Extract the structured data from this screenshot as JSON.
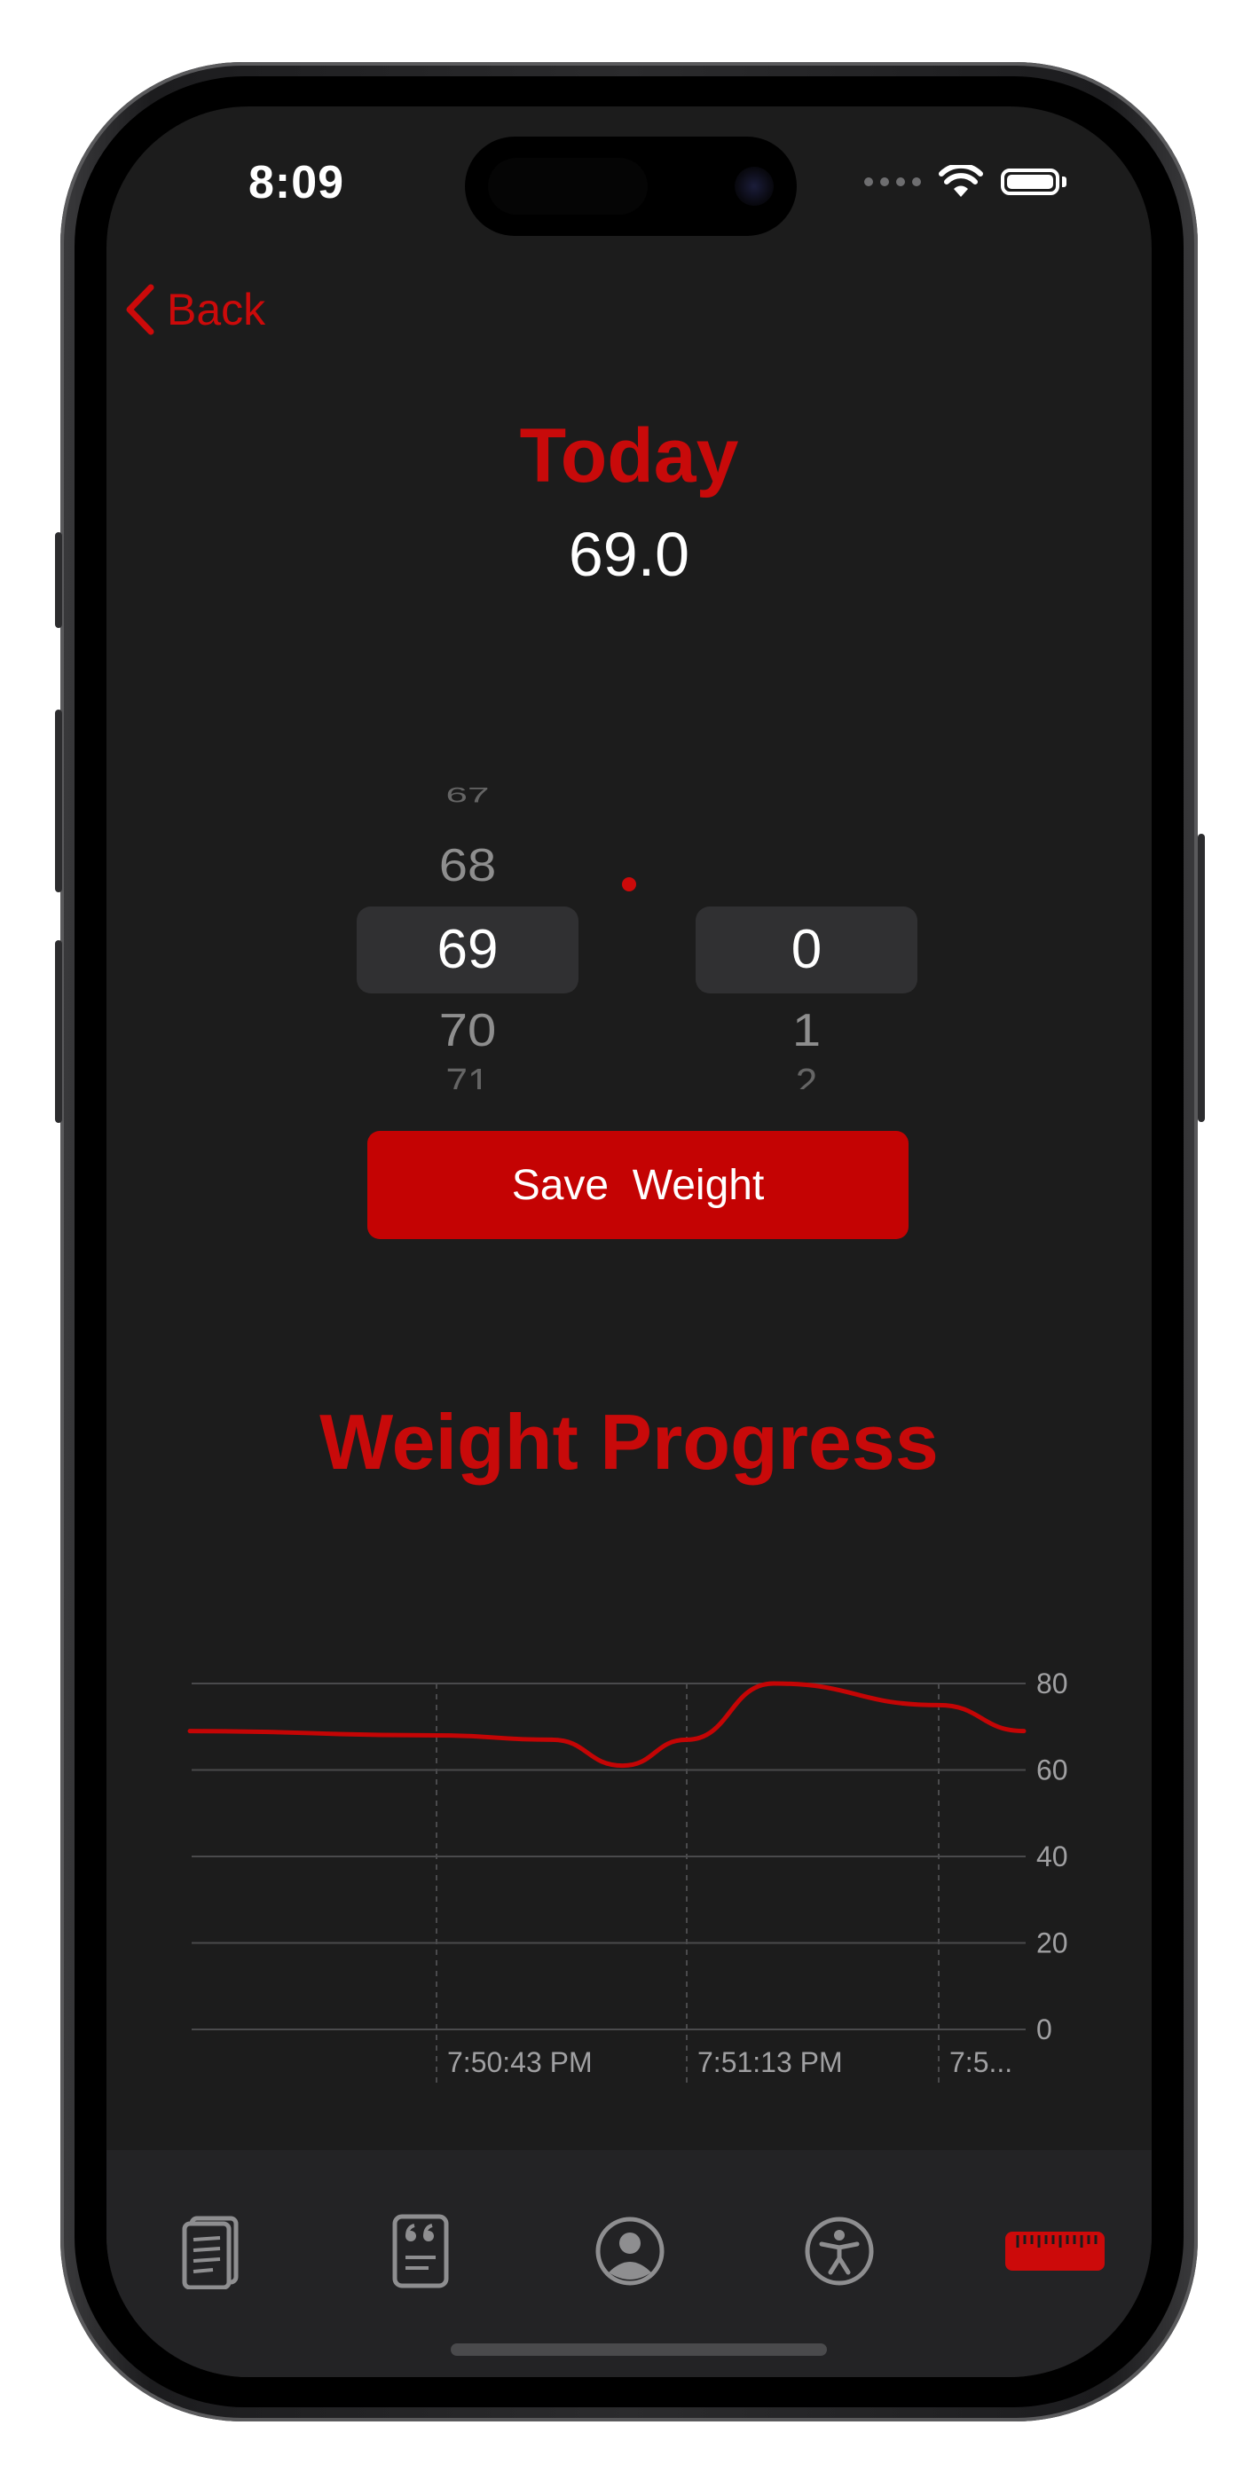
{
  "status_bar": {
    "time": "8:09"
  },
  "nav": {
    "back_label": "Back"
  },
  "today": {
    "title": "Today",
    "value": "69.0"
  },
  "picker": {
    "whole": {
      "items": [
        "67",
        "68",
        "69",
        "70",
        "71"
      ],
      "selected": "69"
    },
    "decimal": {
      "items": [
        "",
        "",
        "0",
        "1",
        "2"
      ],
      "selected": "0"
    },
    "separator_color": "#cc0a0a"
  },
  "actions": {
    "save_label": "Save  Weight"
  },
  "progress": {
    "title": "Weight Progress"
  },
  "chart_data": {
    "type": "line",
    "title": "",
    "xlabel": "",
    "ylabel": "",
    "ylim": [
      0,
      80
    ],
    "y_ticks": [
      "80",
      "60",
      "40",
      "20",
      "0"
    ],
    "x_ticks": [
      "7:50:43 PM",
      "7:51:13 PM",
      "7:5..."
    ],
    "grid": true,
    "series": [
      {
        "color": "#c40505",
        "points": [
          {
            "x": "7:50:15 PM",
            "y": 69
          },
          {
            "x": "7:50:43 PM",
            "y": 68
          },
          {
            "x": "7:50:57 PM",
            "y": 67
          },
          {
            "x": "7:51:05 PM",
            "y": 61
          },
          {
            "x": "7:51:13 PM",
            "y": 67
          },
          {
            "x": "7:51:25 PM",
            "y": 80
          },
          {
            "x": "7:51:43 PM",
            "y": 75
          },
          {
            "x": "7:51:53 PM",
            "y": 69
          }
        ]
      }
    ]
  },
  "tab_bar": {
    "tabs": [
      {
        "icon": "document-stack-icon",
        "active": false
      },
      {
        "icon": "quote-card-icon",
        "active": false
      },
      {
        "icon": "person-circle-icon",
        "active": false
      },
      {
        "icon": "accessibility-icon",
        "active": false
      },
      {
        "icon": "ruler-icon",
        "active": true
      }
    ],
    "active_color": "#cc0a0a",
    "inactive_color": "#8e8e90"
  }
}
